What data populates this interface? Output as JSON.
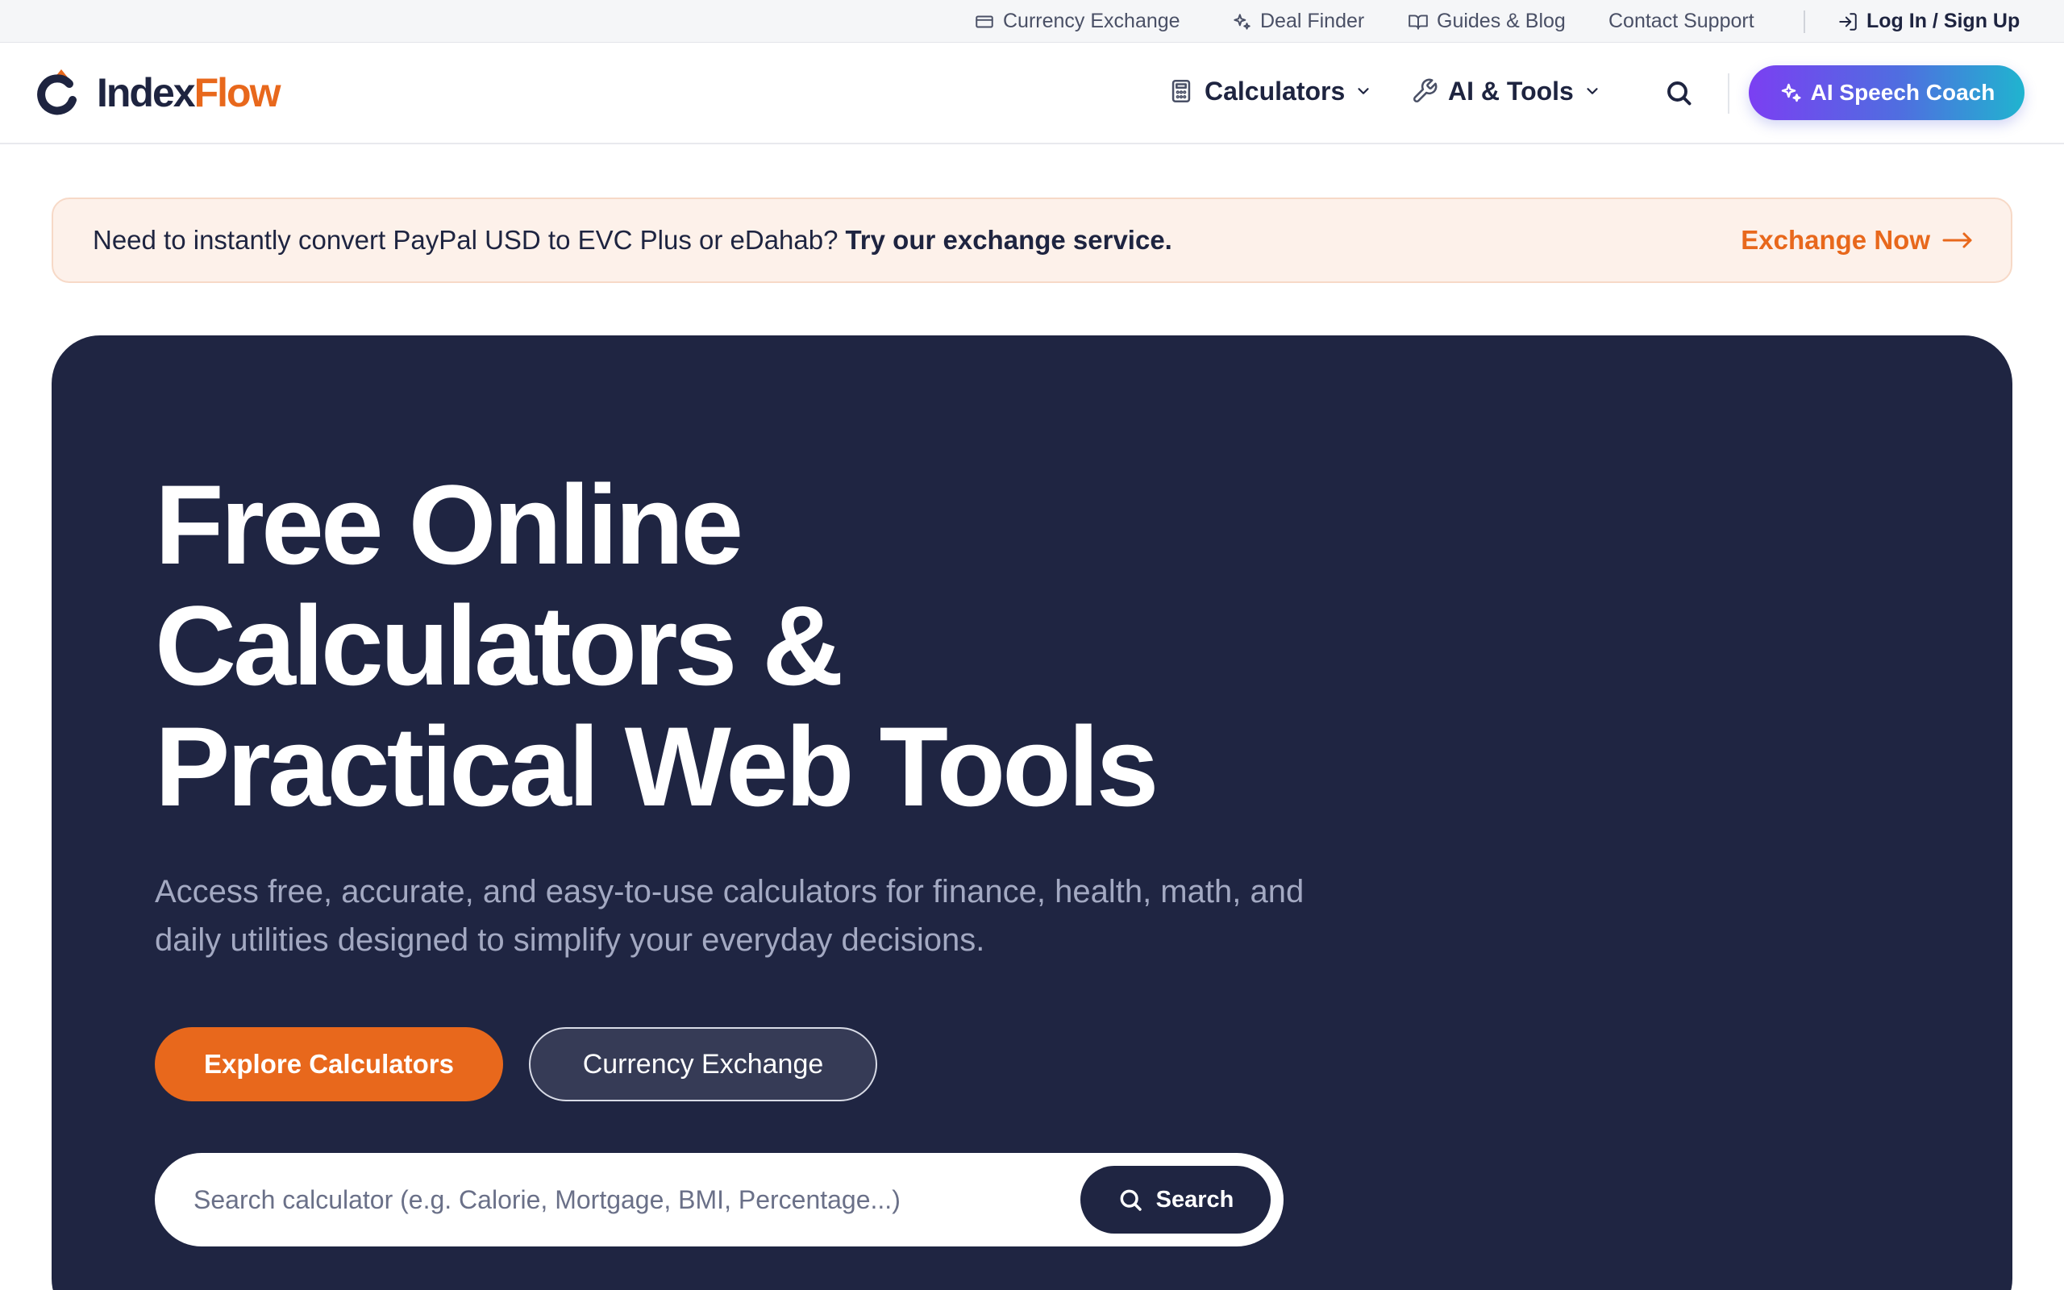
{
  "utility_bar": {
    "currency_exchange": "Currency Exchange",
    "deal_finder": "Deal Finder",
    "guides_blog": "Guides & Blog",
    "contact_support": "Contact Support",
    "login": "Log In / Sign Up"
  },
  "brand": {
    "name_part1": "Index",
    "name_part2": "Flow",
    "accent_color": "#e8681c",
    "navy_color": "#1f2542"
  },
  "nav": {
    "calculators": "Calculators",
    "ai_tools": "AI & Tools",
    "ai_speech_coach": "AI Speech Coach"
  },
  "promo": {
    "text": "Need to instantly convert PayPal USD to EVC Plus or eDahab?",
    "emphasis": "Try our exchange service.",
    "cta": "Exchange Now"
  },
  "hero": {
    "title_line1": "Free Online",
    "title_line2": "Calculators &",
    "title_line3": "Practical Web Tools",
    "subtitle": "Access free, accurate, and easy-to-use calculators for finance, health, math, and daily utilities designed to simplify your everyday decisions.",
    "primary_button": "Explore Calculators",
    "secondary_button": "Currency Exchange",
    "search_placeholder": "Search calculator (e.g. Calorie, Mortgage, BMI, Percentage...)",
    "search_button": "Search"
  }
}
